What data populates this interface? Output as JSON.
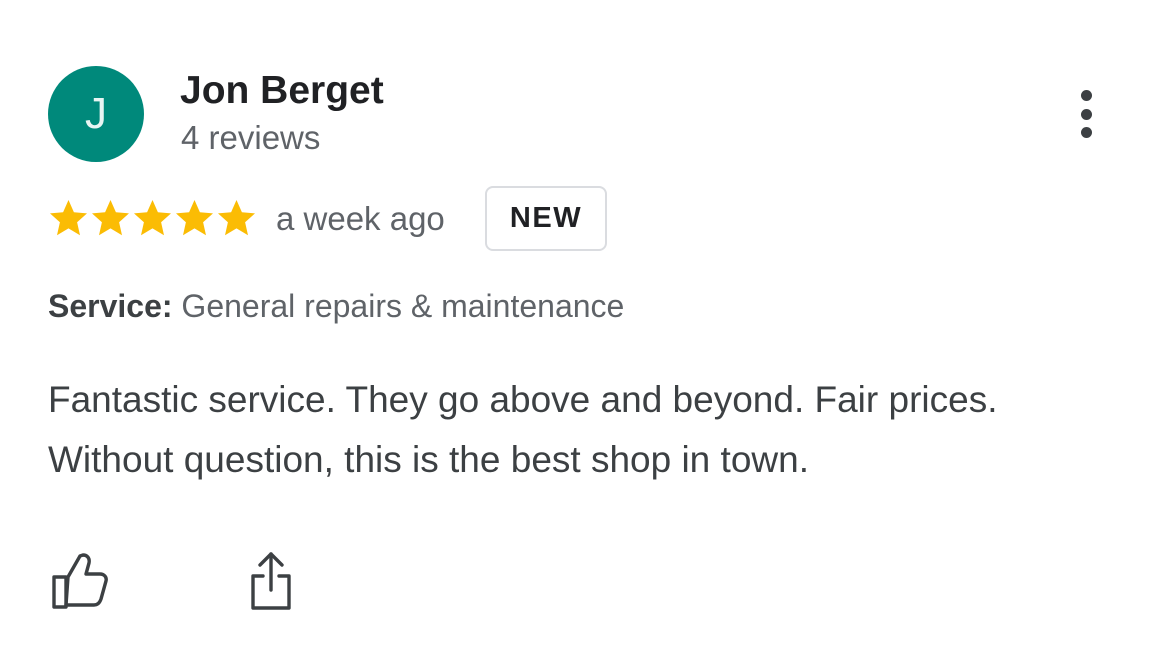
{
  "reviewer": {
    "avatar_initial": "J",
    "avatar_color": "#00897b",
    "name": "Jon Berget",
    "review_count": "4 reviews"
  },
  "menu": {
    "icon": "more-vert-icon"
  },
  "rating": {
    "stars": 5,
    "max_stars": 5,
    "star_color": "#fbbc04",
    "icon": "star-icon",
    "time_ago": "a week ago",
    "badge": "NEW"
  },
  "service": {
    "label": "Service:",
    "value": "General repairs & maintenance"
  },
  "review": {
    "text": "Fantastic service. They go above and beyond. Fair prices. Without question, this is the best shop in town."
  },
  "actions": {
    "like_icon": "thumbs-up-icon",
    "share_icon": "share-icon"
  }
}
